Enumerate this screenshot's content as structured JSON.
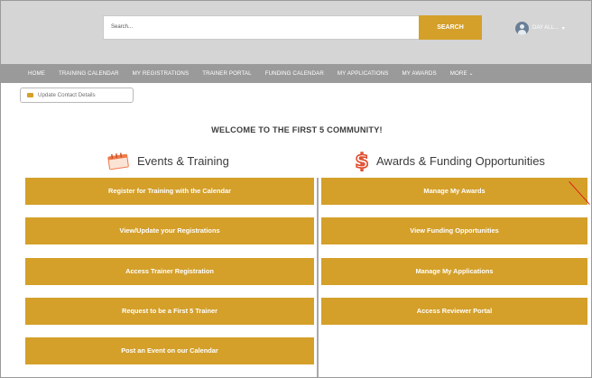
{
  "header": {
    "search_placeholder": "Search...",
    "search_button": "SEARCH",
    "user_name": "DAY ALL...",
    "user_chevron": "▾"
  },
  "nav": {
    "items": [
      "HOME",
      "TRAINING CALENDAR",
      "MY REGISTRATIONS",
      "TRAINER PORTAL",
      "FUNDING CALENDAR",
      "MY APPLICATIONS",
      "MY AWARDS",
      "MORE ⌄"
    ]
  },
  "update_contact": {
    "label": "Update Contact Details",
    "icon": "id-card-icon"
  },
  "welcome": "WELCOME TO THE FIRST 5 COMMUNITY!",
  "left": {
    "heading": "Events & Training",
    "icon": "calendar-icon",
    "buttons": [
      "Register for Training with the Calendar",
      "View/Update your Registrations",
      "Access Trainer Registration",
      "Request to be a First 5 Trainer",
      "Post an Event on our Calendar"
    ]
  },
  "right": {
    "heading": "Awards & Funding Opportunities",
    "icon": "dollar-icon",
    "buttons": [
      "Manage My Awards",
      "View Funding Opportunities",
      "Manage My Applications",
      "Access Reviewer Portal"
    ]
  },
  "colors": {
    "accent": "#d4a02a",
    "nav": "#9a9a9a",
    "topbar": "#d5d5d5"
  }
}
